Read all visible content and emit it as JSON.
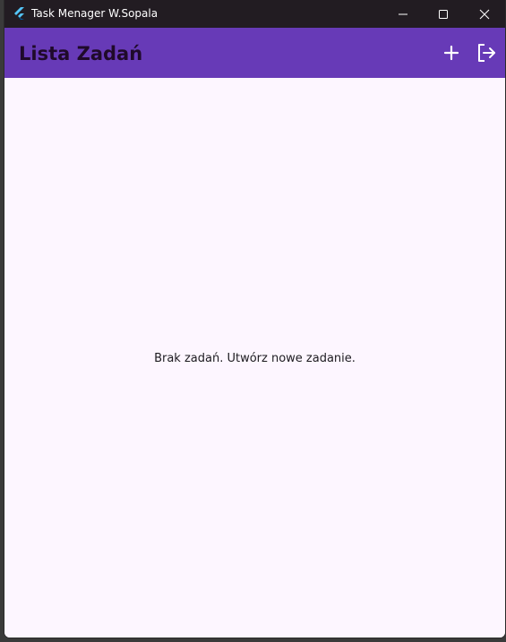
{
  "window": {
    "title": "Task Menager W.Sopala",
    "app_icon": "flutter-logo-icon",
    "controls": [
      "minimize-icon",
      "maximize-icon",
      "close-icon"
    ]
  },
  "appbar": {
    "title": "Lista Zadań",
    "actions": [
      "add-icon",
      "logout-icon"
    ],
    "color": "#673ab7"
  },
  "main": {
    "empty_message": "Brak zadań. Utwórz nowe zadanie.",
    "background": "#fdf6ff"
  }
}
